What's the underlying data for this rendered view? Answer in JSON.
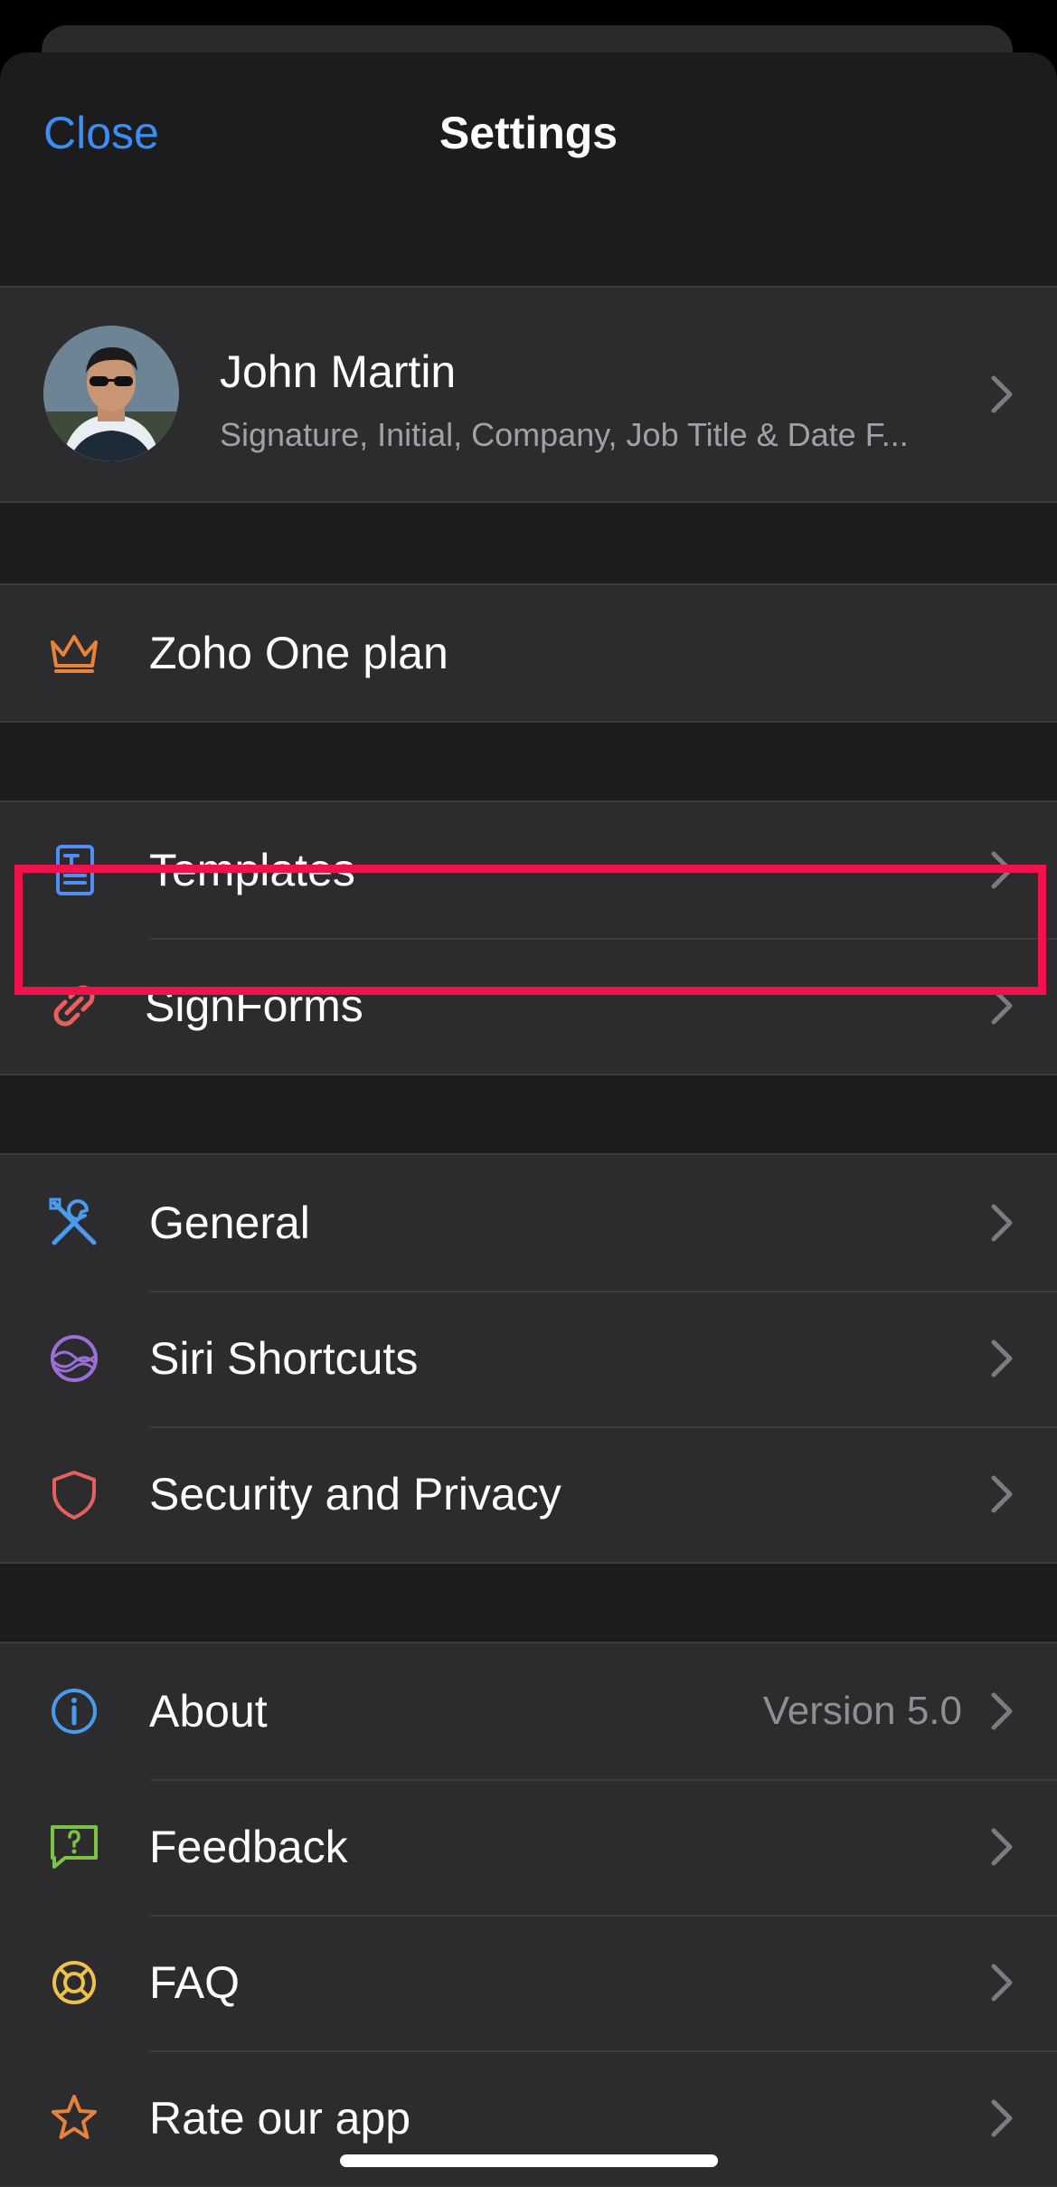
{
  "nav": {
    "close_label": "Close",
    "title": "Settings"
  },
  "profile": {
    "name": "John Martin",
    "subtitle": "Signature, Initial, Company, Job Title & Date F..."
  },
  "plan": {
    "label": "Zoho One plan",
    "icon": "crown-icon",
    "icon_color": "#e8823a"
  },
  "group_templates": [
    {
      "label": "Templates",
      "icon": "template-icon",
      "icon_color": "#4f8ef7",
      "highlighted": true
    },
    {
      "label": "SignForms",
      "icon": "link-icon",
      "icon_color": "#e5605e"
    }
  ],
  "group_general": [
    {
      "label": "General",
      "icon": "tools-icon",
      "icon_color": "#4a9bf0"
    },
    {
      "label": "Siri Shortcuts",
      "icon": "siri-icon",
      "icon_color": "#9a6fd6"
    },
    {
      "label": "Security and Privacy",
      "icon": "shield-icon",
      "icon_color": "#e5605e"
    }
  ],
  "group_about": [
    {
      "label": "About",
      "value": "Version 5.0",
      "icon": "info-icon",
      "icon_color": "#4a9bf0"
    },
    {
      "label": "Feedback",
      "icon": "feedback-icon",
      "icon_color": "#7cc243"
    },
    {
      "label": "FAQ",
      "icon": "lifebuoy-icon",
      "icon_color": "#f0c24a"
    },
    {
      "label": "Rate our app",
      "icon": "star-icon",
      "icon_color": "#e8823a"
    }
  ],
  "colors": {
    "accent": "#3a8ef6",
    "highlight": "#f0134b",
    "background": "#1c1c1e",
    "cell": "#2c2c2e"
  }
}
